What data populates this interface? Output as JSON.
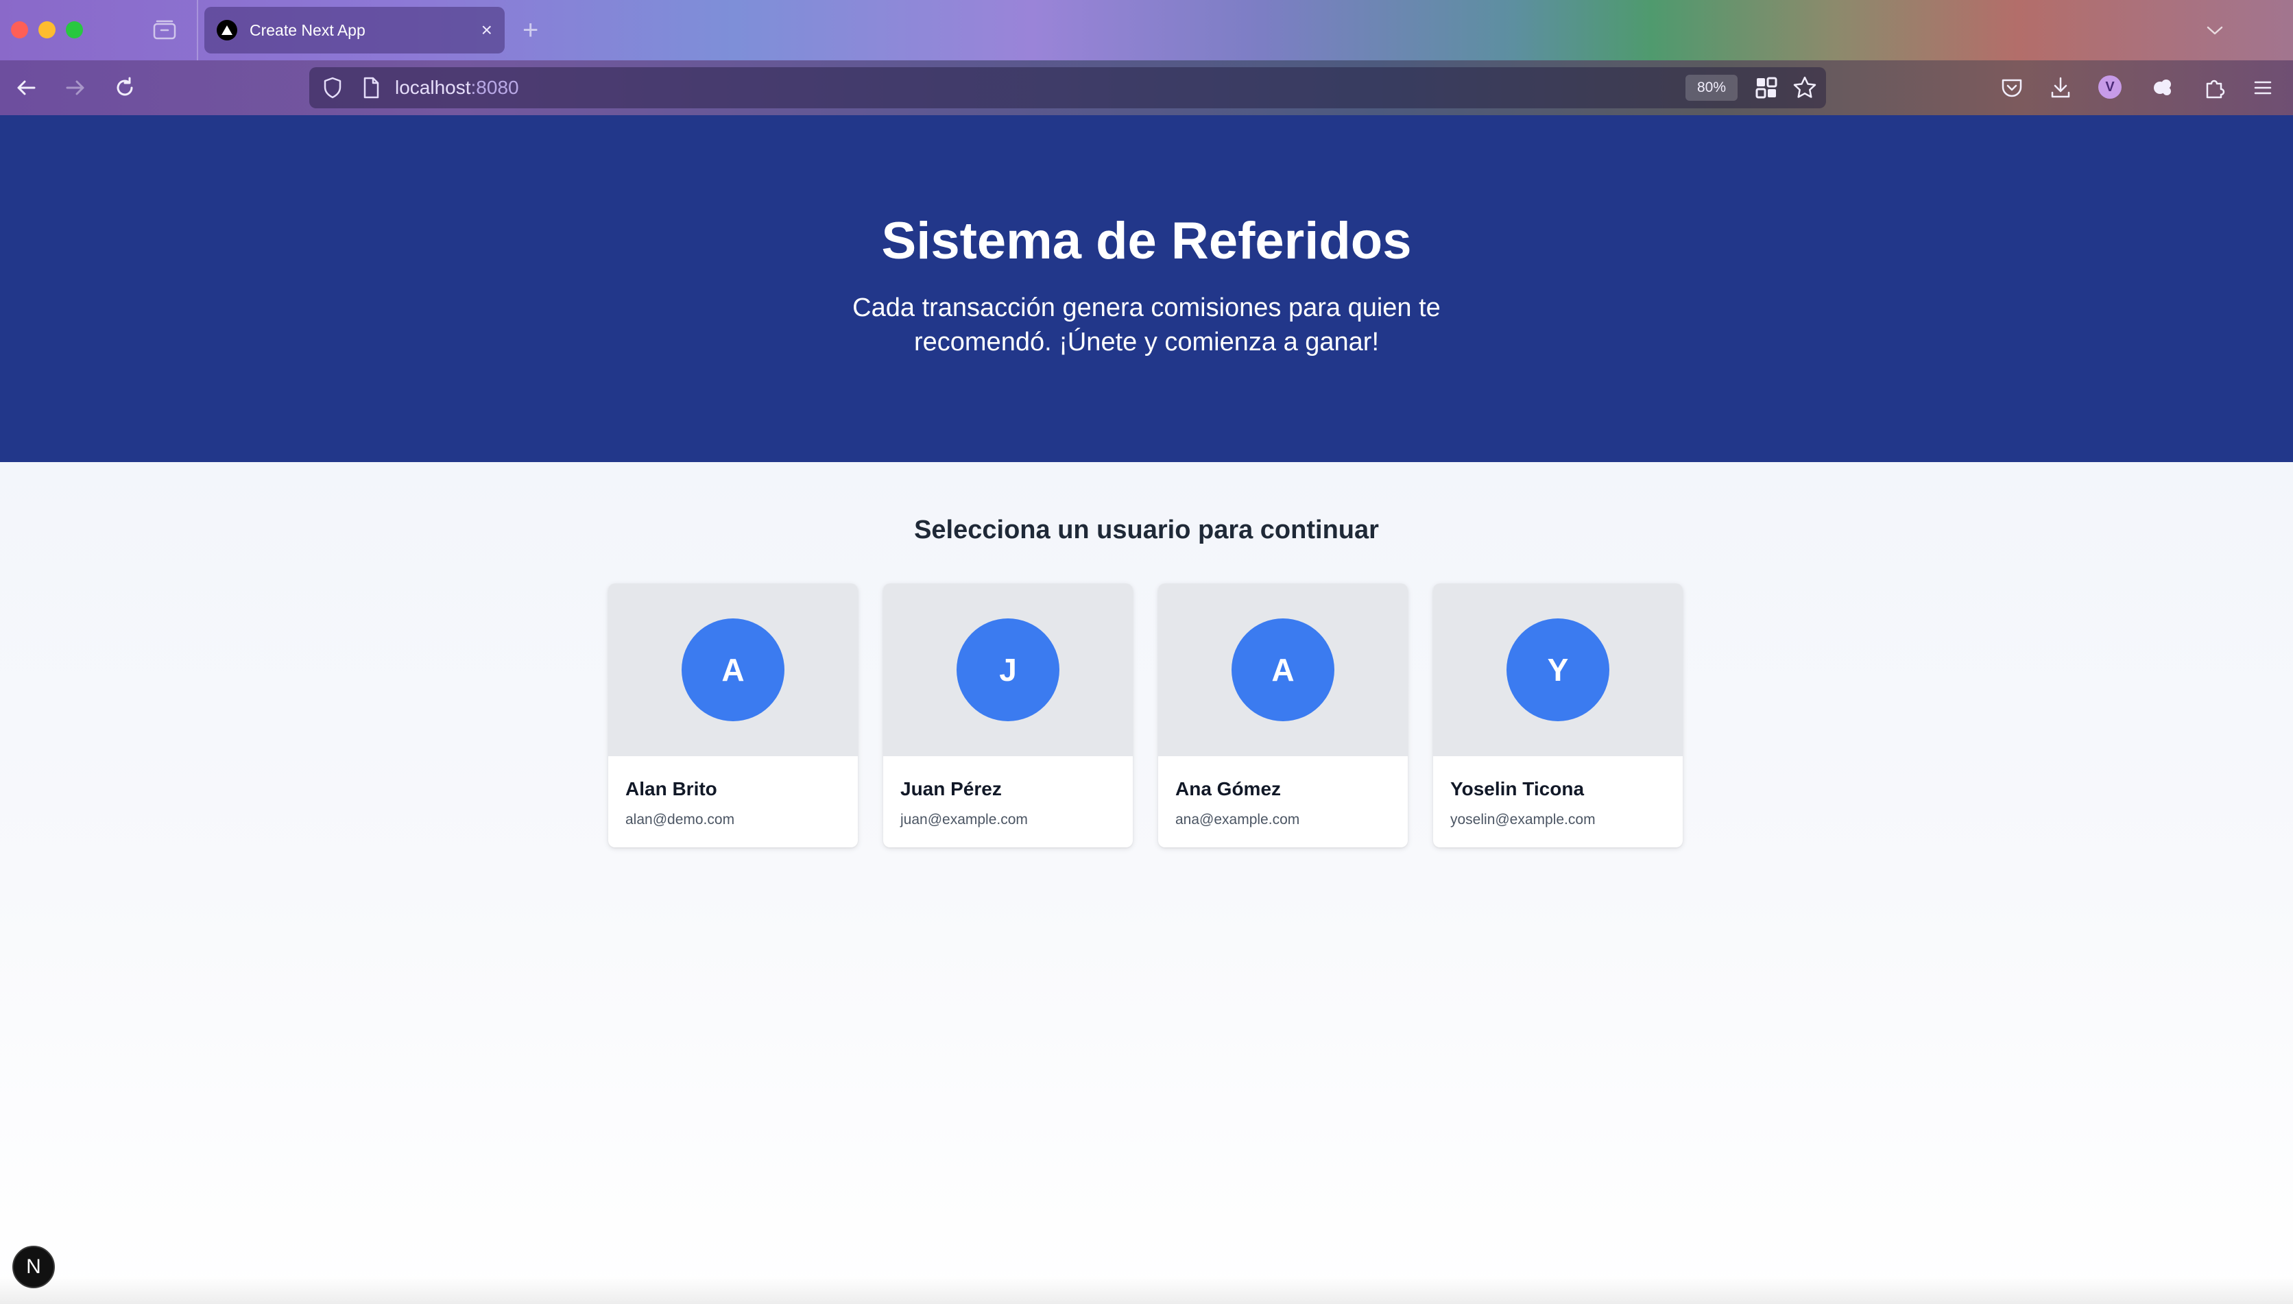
{
  "browser": {
    "tab_title": "Create Next App",
    "tab_close_glyph": "×",
    "new_tab_glyph": "+",
    "url_host": "localhost",
    "url_port": ":8080",
    "zoom": "80%",
    "profile_initial": "V",
    "icons": [
      "tab-manager-icon",
      "back-icon",
      "forward-icon",
      "reload-icon",
      "shield-icon",
      "page-icon",
      "qr-extension-icon",
      "bookmark-star-icon",
      "pocket-icon",
      "download-icon",
      "extension-icon",
      "extensions-puzzle-icon",
      "menu-icon",
      "tab-list-chevron-icon"
    ]
  },
  "hero": {
    "title": "Sistema de Referidos",
    "subtitle": "Cada transacción genera comisiones para quien te recomendó. ¡Únete y comienza a ganar!"
  },
  "section": {
    "title": "Selecciona un usuario para continuar"
  },
  "users": [
    {
      "initial": "A",
      "name": "Alan Brito",
      "email": "alan@demo.com"
    },
    {
      "initial": "J",
      "name": "Juan Pérez",
      "email": "juan@example.com"
    },
    {
      "initial": "A",
      "name": "Ana Gómez",
      "email": "ana@example.com"
    },
    {
      "initial": "Y",
      "name": "Yoselin Ticona",
      "email": "yoselin@example.com"
    }
  ],
  "dev_badge": "N",
  "colors": {
    "hero_bg": "#22378a",
    "avatar_bg": "#3b7bf0",
    "card_top_bg": "#e5e7eb"
  }
}
